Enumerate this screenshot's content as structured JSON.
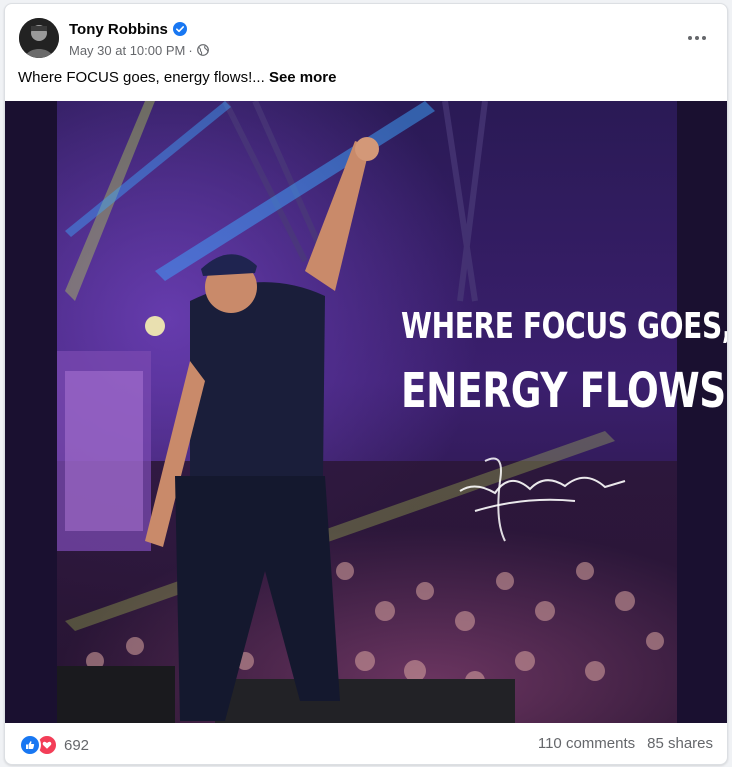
{
  "post": {
    "author": "Tony Robbins",
    "date": "May 30 at 10:00 PM",
    "separator": "·",
    "caption_text": "Where FOCUS goes, energy flows!...",
    "see_more": "See more"
  },
  "image": {
    "line1": "WHERE FOCUS GOES,",
    "line2": "ENERGY FLOWS",
    "signature": "Tony Robbins"
  },
  "engagement": {
    "reaction_count": "692",
    "comments": "110 comments",
    "shares": "85 shares"
  },
  "icons": {
    "verified": "verified-badge-icon",
    "audience": "globe-icon",
    "more": "more-options-icon",
    "like": "like-reaction-icon",
    "love": "love-reaction-icon"
  },
  "colors": {
    "brand_blue": "#1877f2",
    "love_red": "#f33e58",
    "secondary_text": "#65676b"
  }
}
